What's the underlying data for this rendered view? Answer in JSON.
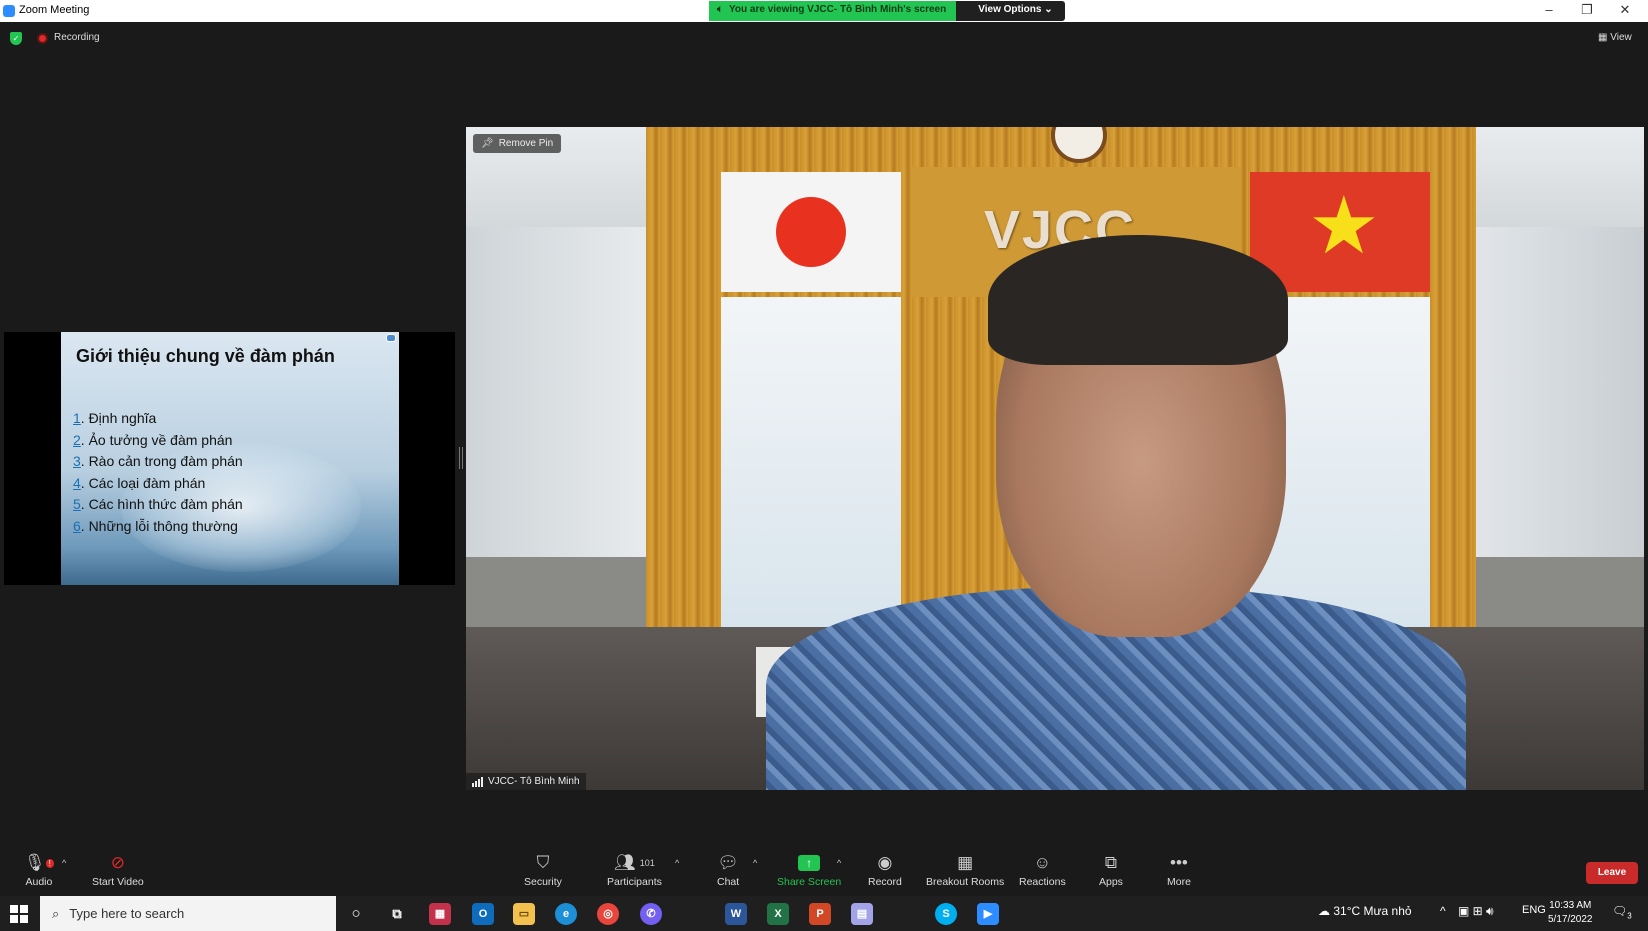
{
  "window": {
    "title": "Zoom Meeting",
    "share_banner": "You are viewing VJCC- Tô Bình Minh's screen",
    "view_options": "View Options",
    "controls": [
      "–",
      "❐",
      "✕"
    ]
  },
  "topbar": {
    "recording_label": "Recording",
    "view_label": "View"
  },
  "shared_slide": {
    "title": "Giới thiệu chung về đàm phán",
    "items": [
      {
        "num": "1",
        "text": ". Định nghĩa"
      },
      {
        "num": "2",
        "text": ". Ảo tưởng về đàm phán"
      },
      {
        "num": "3",
        "text": ". Rào cản trong đàm phán"
      },
      {
        "num": "4",
        "text": ". Các loại đàm phán"
      },
      {
        "num": "5",
        "text": ". Các hình thức đàm phán"
      },
      {
        "num": "6",
        "text": ". Những lỗi thông thường"
      }
    ]
  },
  "video": {
    "remove_pin": "Remove Pin",
    "participant_name": "VJCC- Tô Bình Minh",
    "background_logo": "VJCC"
  },
  "toolbar": {
    "audio": "Audio",
    "start_video": "Start Video",
    "security": "Security",
    "participants": "Participants",
    "participants_count": "101",
    "chat": "Chat",
    "share_screen": "Share Screen",
    "record": "Record",
    "breakout_rooms": "Breakout Rooms",
    "reactions": "Reactions",
    "apps": "Apps",
    "more": "More",
    "leave": "Leave",
    "audio_badge": "!"
  },
  "taskbar": {
    "search_placeholder": "Type here to search",
    "weather": "31°C  Mưa nhỏ",
    "language": "ENG",
    "time": "10:33 AM",
    "date": "5/17/2022",
    "notifications": "3"
  },
  "colors": {
    "zoom_blue": "#2d8cff",
    "share_green": "#23c552",
    "leave_red": "#c92a2a",
    "recording_red": "#e02828"
  }
}
